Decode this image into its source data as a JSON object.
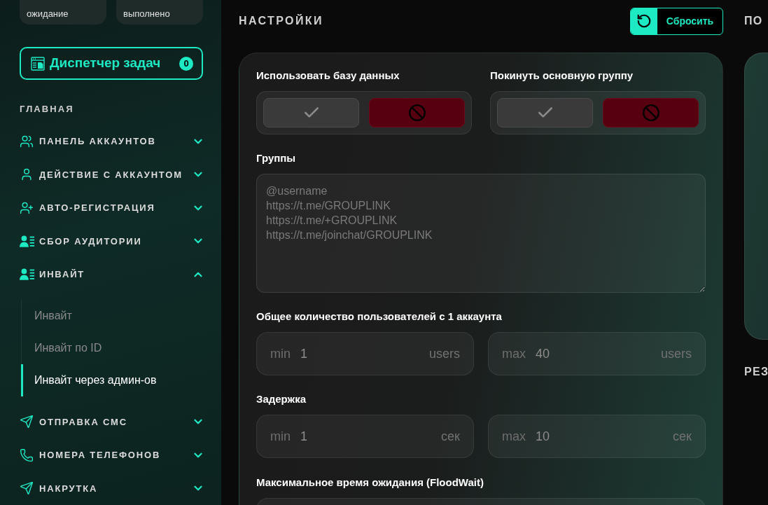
{
  "sidebar": {
    "status_cards": [
      {
        "label": "ожидание"
      },
      {
        "label": "выполнено"
      }
    ],
    "task_manager": {
      "label": "Диспетчер задач",
      "count": "0"
    },
    "section_title": "ГЛАВНАЯ",
    "items": [
      {
        "label": "ПАНЕЛЬ АККАУНТОВ",
        "expanded": false
      },
      {
        "label": "ДЕЙСТВИЕ С АККАУНТОМ",
        "expanded": false
      },
      {
        "label": "АВТО-РЕГИСТРАЦИЯ",
        "expanded": false
      },
      {
        "label": "СБОР АУДИТОРИИ",
        "expanded": false
      },
      {
        "label": "ИНВАЙТ",
        "expanded": true,
        "children": [
          {
            "label": "Инвайт",
            "selected": false
          },
          {
            "label": "Инвайт по ID",
            "selected": false
          },
          {
            "label": "Инвайт через админ-ов",
            "selected": true
          }
        ]
      },
      {
        "label": "ОТПРАВКА СМС",
        "expanded": false
      },
      {
        "label": "НОМЕРА ТЕЛЕФОНОВ",
        "expanded": false
      },
      {
        "label": "НАКРУТКА",
        "expanded": false
      }
    ]
  },
  "settings": {
    "title": "НАСТРОЙКИ",
    "reset_button": "Сбросить",
    "toggles": [
      {
        "label": "Использовать базу данных",
        "enabled": false
      },
      {
        "label": "Покинуть основную группу",
        "enabled": false
      }
    ],
    "groups": {
      "label": "Группы",
      "placeholder": "@username\nhttps://t.me/GROUPLINK\nhttps://t.me/+GROUPLINK\nhttps://t.me/joinchat/GROUPLINK"
    },
    "ranges": [
      {
        "label": "Общее количество пользователей с 1 аккаунта",
        "fields": [
          {
            "prefix": "min",
            "value": "1",
            "unit": "users"
          },
          {
            "prefix": "max",
            "value": "40",
            "unit": "users"
          }
        ]
      },
      {
        "label": "Задержка",
        "fields": [
          {
            "prefix": "min",
            "value": "1",
            "unit": "сек"
          },
          {
            "prefix": "max",
            "value": "10",
            "unit": "сек"
          }
        ]
      }
    ],
    "floodwait": {
      "label": "Максимальное время ожидания (FloodWait)"
    }
  },
  "right_panel": {
    "title": "ПО",
    "results_title": "РЕЗ"
  }
}
